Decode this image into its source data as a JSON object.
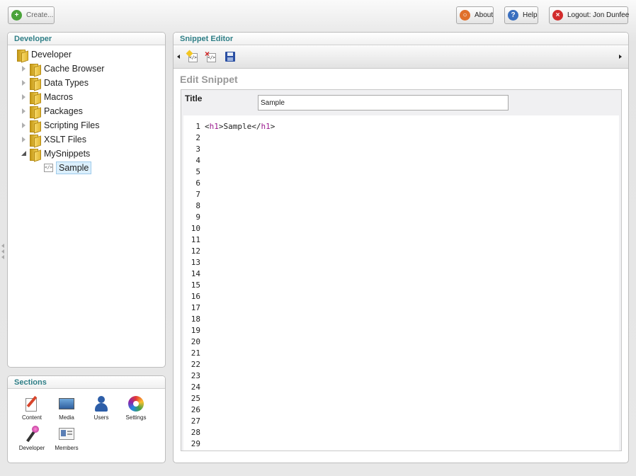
{
  "header": {
    "create_label": "Create...",
    "about_label": "About",
    "help_label": "Help",
    "logout_label": "Logout: Jon Dunfee"
  },
  "tree": {
    "panel_title": "Developer",
    "root_label": "Developer",
    "items": [
      {
        "label": "Cache Browser"
      },
      {
        "label": "Data Types"
      },
      {
        "label": "Macros"
      },
      {
        "label": "Packages"
      },
      {
        "label": "Scripting Files"
      },
      {
        "label": "XSLT Files"
      },
      {
        "label": "MySnippets"
      }
    ],
    "child_label": "Sample"
  },
  "sections": {
    "title": "Sections",
    "items": [
      {
        "label": "Content",
        "icon": "content-icon"
      },
      {
        "label": "Media",
        "icon": "media-icon"
      },
      {
        "label": "Users",
        "icon": "users-icon"
      },
      {
        "label": "Settings",
        "icon": "settings-icon"
      },
      {
        "label": "Developer",
        "icon": "developer-icon"
      },
      {
        "label": "Members",
        "icon": "members-icon"
      }
    ]
  },
  "editor": {
    "panel_title": "Snippet Editor",
    "heading": "Edit Snippet",
    "title_label": "Title",
    "title_value": "Sample",
    "code": {
      "open_tag_lt": "<",
      "open_tag_name": "h1",
      "open_tag_gt": ">",
      "text": "Sample",
      "close_tag_lt": "</",
      "close_tag_name": "h1",
      "close_tag_gt": ">"
    },
    "line_numbers": [
      "1",
      "2",
      "3",
      "4",
      "5",
      "6",
      "7",
      "8",
      "9",
      "10",
      "11",
      "12",
      "13",
      "14",
      "15",
      "16",
      "17",
      "18",
      "19",
      "20",
      "21",
      "22",
      "23",
      "24",
      "25",
      "26",
      "27",
      "28",
      "29"
    ]
  },
  "colors": {
    "panel_title": "#2f7f87",
    "tag_color": "#9b1b8e",
    "selection": "#dbeffc"
  }
}
